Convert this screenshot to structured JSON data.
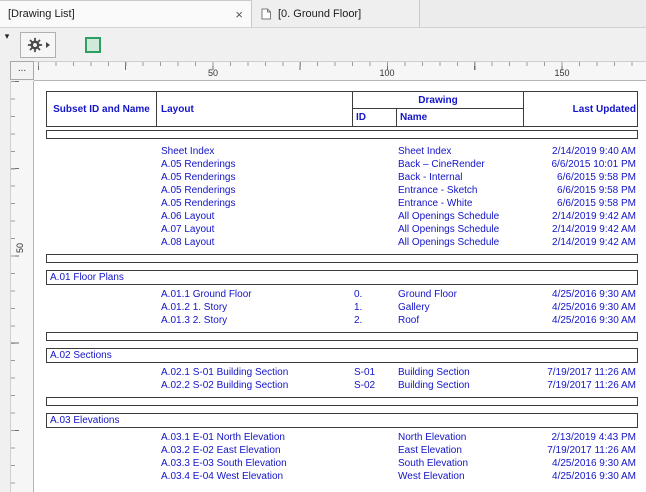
{
  "tabs": [
    {
      "label": "[Drawing List]",
      "active": true
    },
    {
      "label": "[0. Ground Floor]",
      "active": false
    }
  ],
  "icons": {
    "close": "×",
    "tab_overflow": "▾",
    "corner_more": "..."
  },
  "ruler": {
    "horizontal_labels": [
      "50",
      "100",
      "150"
    ],
    "vertical_labels": [
      "50"
    ]
  },
  "colors": {
    "text_blue": "#1414c8",
    "table_border": "#3c3c3c",
    "green_tool": "#2f9e62",
    "chrome": "#f0f0f0",
    "canvas": "#ffffff"
  },
  "table": {
    "headers": {
      "subset": "Subset ID and Name",
      "layout": "Layout",
      "drawing": "Drawing",
      "id": "ID",
      "name": "Name",
      "last_updated": "Last Updated"
    },
    "groups": [
      {
        "subset": "",
        "rows": [
          {
            "layout": "Sheet Index",
            "id": "",
            "name": "Sheet Index",
            "updated": "2/14/2019 9:40 AM"
          },
          {
            "layout": "A.05 Renderings",
            "id": "",
            "name": "Back – CineRender",
            "updated": "6/6/2015 10:01 PM"
          },
          {
            "layout": "A.05 Renderings",
            "id": "",
            "name": "Back - Internal",
            "updated": "6/6/2015 9:58 PM"
          },
          {
            "layout": "A.05 Renderings",
            "id": "",
            "name": "Entrance - Sketch",
            "updated": "6/6/2015 9:58 PM"
          },
          {
            "layout": "A.05 Renderings",
            "id": "",
            "name": "Entrance - White",
            "updated": "6/6/2015 9:58 PM"
          },
          {
            "layout": "A.06 Layout",
            "id": "",
            "name": "All Openings Schedule",
            "updated": "2/14/2019 9:42 AM"
          },
          {
            "layout": "A.07 Layout",
            "id": "",
            "name": "All Openings Schedule",
            "updated": "2/14/2019 9:42 AM"
          },
          {
            "layout": "A.08 Layout",
            "id": "",
            "name": "All Openings Schedule",
            "updated": "2/14/2019 9:42 AM"
          }
        ]
      },
      {
        "subset": "A.01 Floor Plans",
        "rows": [
          {
            "layout": "A.01.1 Ground Floor",
            "id": "0.",
            "name": "Ground Floor",
            "updated": "4/25/2016 9:30 AM"
          },
          {
            "layout": "A.01.2 1. Story",
            "id": "1.",
            "name": "Gallery",
            "updated": "4/25/2016 9:30 AM"
          },
          {
            "layout": "A.01.3 2. Story",
            "id": "2.",
            "name": "Roof",
            "updated": "4/25/2016 9:30 AM"
          }
        ]
      },
      {
        "subset": "A.02 Sections",
        "rows": [
          {
            "layout": "A.02.1 S-01 Building Section",
            "id": "S-01",
            "name": "Building Section",
            "updated": "7/19/2017 11:26 AM"
          },
          {
            "layout": "A.02.2 S-02 Building Section",
            "id": "S-02",
            "name": "Building Section",
            "updated": "7/19/2017 11:26 AM"
          }
        ]
      },
      {
        "subset": "A.03 Elevations",
        "rows": [
          {
            "layout": "A.03.1 E-01 North Elevation",
            "id": "",
            "name": "North Elevation",
            "updated": "2/13/2019 4:43 PM"
          },
          {
            "layout": "A.03.2 E-02 East Elevation",
            "id": "",
            "name": "East Elevation",
            "updated": "7/19/2017 11:26 AM"
          },
          {
            "layout": "A.03.3 E-03 South Elevation",
            "id": "",
            "name": "South Elevation",
            "updated": "4/25/2016 9:30 AM"
          },
          {
            "layout": "A.03.4 E-04 West Elevation",
            "id": "",
            "name": "West Elevation",
            "updated": "4/25/2016 9:30 AM"
          }
        ]
      }
    ]
  }
}
